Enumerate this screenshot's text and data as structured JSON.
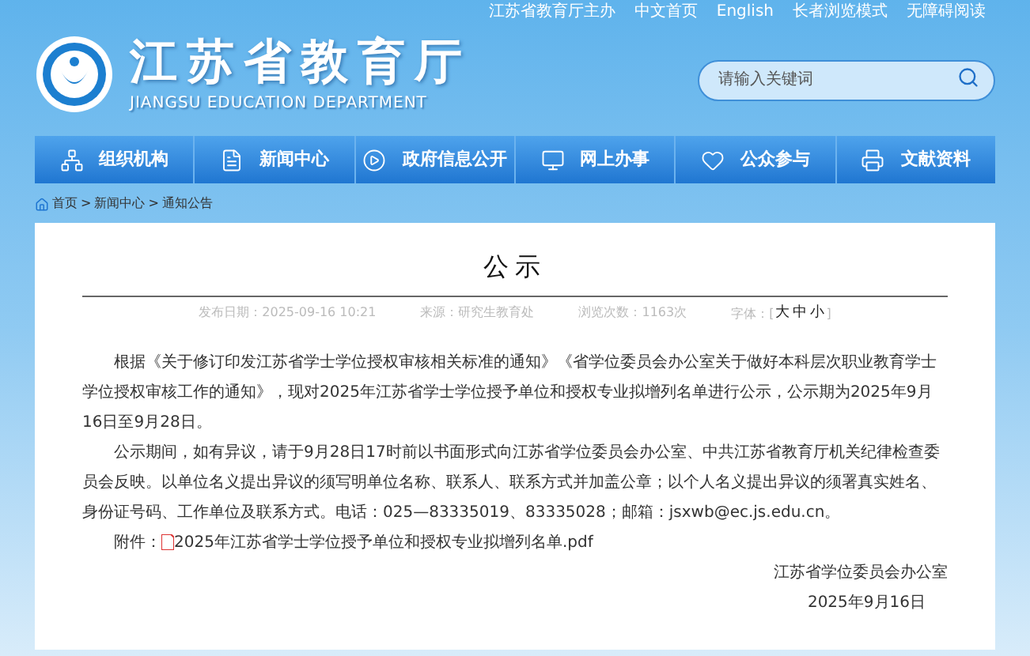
{
  "top_links": [
    {
      "label": "江苏省教育厅主办"
    },
    {
      "label": "中文首页"
    },
    {
      "label": "English"
    },
    {
      "label": "长者浏览模式"
    },
    {
      "label": "无障碍阅读"
    }
  ],
  "site": {
    "title": "江苏省教育厅",
    "subtitle": "JIANGSU EDUCATION DEPARTMENT"
  },
  "search": {
    "placeholder": "请输入关键词"
  },
  "nav": [
    {
      "label": "组织机构"
    },
    {
      "label": "新闻中心"
    },
    {
      "label": "政府信息公开"
    },
    {
      "label": "网上办事"
    },
    {
      "label": "公众参与"
    },
    {
      "label": "文献资料"
    }
  ],
  "breadcrumb": [
    {
      "label": "首页",
      "separator": ">"
    },
    {
      "label": "新闻中心",
      "separator": ">"
    },
    {
      "label": "通知公告"
    }
  ],
  "article": {
    "title": "公示",
    "meta": [
      {
        "label": "发布日期：",
        "value": "2025-09-16 10:21"
      },
      {
        "label": "来源：",
        "value": "研究生教育处"
      },
      {
        "label": "浏览次数：",
        "value": "1163次"
      }
    ],
    "font_size": {
      "label": "字体：",
      "open": "[",
      "options": [
        "大",
        "中",
        "小"
      ],
      "close": "]"
    },
    "paragraphs": [
      "根据《关于修订印发江苏省学士学位授权审核相关标准的通知》《省学位委员会办公室关于做好本科层次职业教育学士学位授权审核工作的通知》，现对2025年江苏省学士学位授予单位和授权专业拟增列名单进行公示，公示期为2025年9月16日至9月28日。",
      "公示期间，如有异议，请于9月28日17时前以书面形式向江苏省学位委员会办公室、中共江苏省教育厅机关纪律检查委员会反映。以单位名义提出异议的须写明单位名称、联系人、联系方式并加盖公章；以个人名义提出异议的须署真实姓名、身份证号码、工作单位及联系方式。电话：025—83335019、83335028；邮箱：jsxwb@ec.js.edu.cn。"
    ],
    "attachment": {
      "label": "附件：",
      "file": "2025年江苏省学士学位授予单位和授权专业拟增列名单.pdf"
    },
    "signature": "江苏省学位委员会办公室",
    "date": "2025年9月16日"
  }
}
